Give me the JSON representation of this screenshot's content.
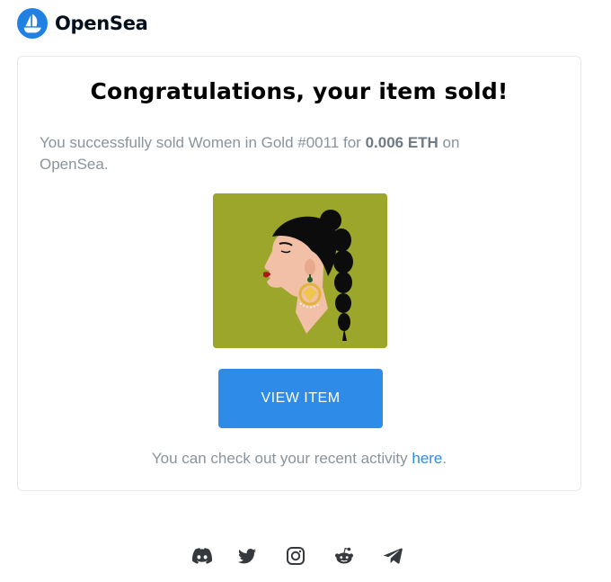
{
  "header": {
    "brand_name": "OpenSea"
  },
  "card": {
    "title": "Congratulations, your item sold!",
    "message_prefix": "You successfully sold Women in Gold #0011 for ",
    "price": "0.006 ETH",
    "message_suffix": " on OpenSea.",
    "nft_image_icon": "woman-profile-illustration",
    "view_button_label": "VIEW ITEM",
    "activity_text": "You can check out your recent activity ",
    "activity_link": "here",
    "activity_end": "."
  },
  "footer": {
    "social": [
      {
        "icon": "discord-icon"
      },
      {
        "icon": "twitter-icon"
      },
      {
        "icon": "instagram-icon"
      },
      {
        "icon": "reddit-icon"
      },
      {
        "icon": "telegram-icon"
      }
    ]
  },
  "colors": {
    "brand_blue": "#2081e2",
    "button_blue": "#2e8ce8",
    "nft_background": "#9ba62b",
    "muted_text": "#8a939b"
  }
}
